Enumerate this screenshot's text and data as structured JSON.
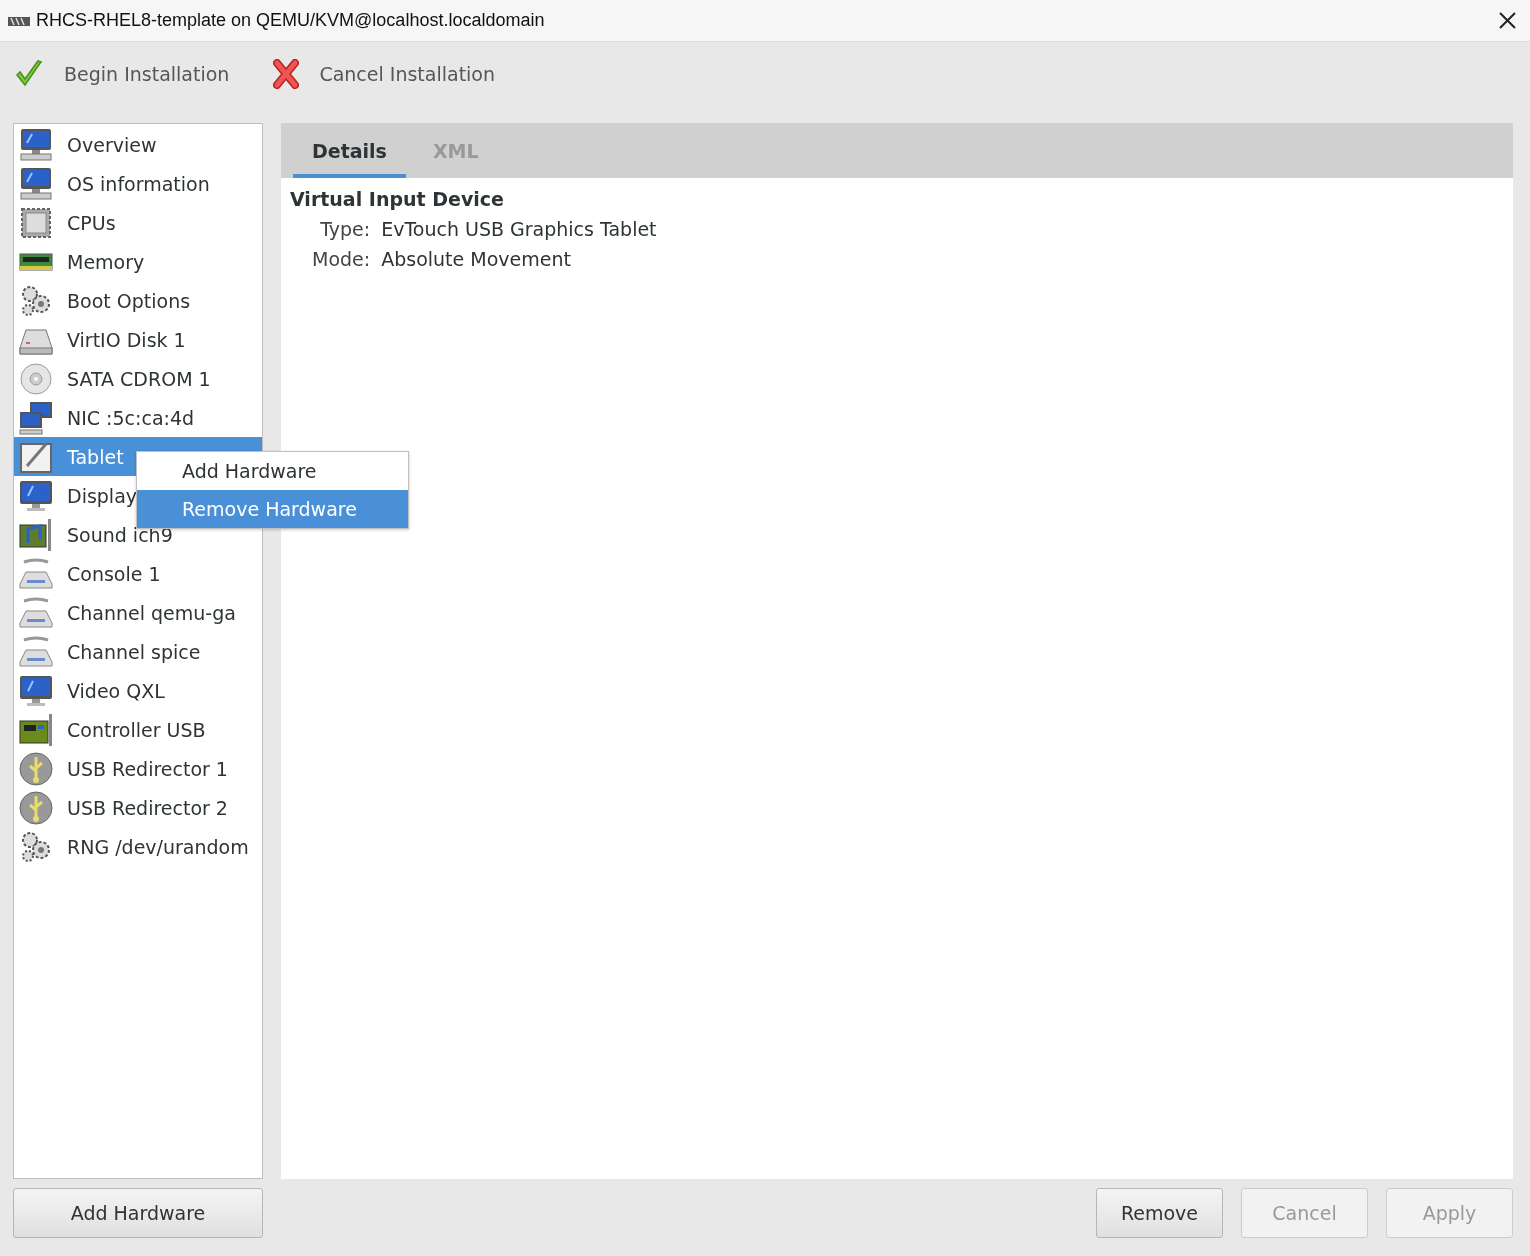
{
  "window": {
    "title": "RHCS-RHEL8-template on QEMU/KVM@localhost.localdomain"
  },
  "toolbar": [
    {
      "kind": "begin",
      "label": "Begin Installation"
    },
    {
      "kind": "cancel",
      "label": "Cancel Installation"
    }
  ],
  "sidebar": {
    "items": [
      {
        "kind": "computer",
        "label": "Overview",
        "selected": false
      },
      {
        "kind": "computer",
        "label": "OS information",
        "selected": false
      },
      {
        "kind": "chip",
        "label": "CPUs",
        "selected": false
      },
      {
        "kind": "memory",
        "label": "Memory",
        "selected": false
      },
      {
        "kind": "gears",
        "label": "Boot Options",
        "selected": false
      },
      {
        "kind": "disk",
        "label": "VirtIO Disk 1",
        "selected": false
      },
      {
        "kind": "cdrom",
        "label": "SATA CDROM 1",
        "selected": false
      },
      {
        "kind": "network",
        "label": "NIC :5c:ca:4d",
        "selected": false
      },
      {
        "kind": "tablet",
        "label": "Tablet",
        "selected": true
      },
      {
        "kind": "monitor",
        "label": "Display",
        "selected": false
      },
      {
        "kind": "sound",
        "label": "Sound ich9",
        "selected": false
      },
      {
        "kind": "serial",
        "label": "Console 1",
        "selected": false
      },
      {
        "kind": "serial",
        "label": "Channel qemu-ga",
        "selected": false
      },
      {
        "kind": "serial",
        "label": "Channel spice",
        "selected": false
      },
      {
        "kind": "monitor",
        "label": "Video QXL",
        "selected": false
      },
      {
        "kind": "card",
        "label": "Controller USB",
        "selected": false
      },
      {
        "kind": "usb",
        "label": "USB Redirector 1",
        "selected": false
      },
      {
        "kind": "usb",
        "label": "USB Redirector 2",
        "selected": false
      },
      {
        "kind": "gears",
        "label": "RNG /dev/urandom",
        "selected": false
      }
    ],
    "button": {
      "label": "Add Hardware",
      "disabled": false
    }
  },
  "tabs": [
    {
      "label": "Details",
      "selected": true
    },
    {
      "label": "XML",
      "selected": false
    }
  ],
  "details": {
    "heading": "Virtual Input Device",
    "fields": [
      {
        "label": "Type:",
        "value": "EvTouch USB Graphics Tablet"
      },
      {
        "label": "Mode:",
        "value": "Absolute Movement"
      }
    ]
  },
  "context_menu": {
    "items": [
      {
        "label": "Add Hardware",
        "selected": false
      },
      {
        "label": "Remove Hardware",
        "selected": true
      }
    ]
  },
  "buttons": [
    {
      "label": "Remove",
      "disabled": false
    },
    {
      "label": "Cancel",
      "disabled": true
    },
    {
      "label": "Apply",
      "disabled": true
    }
  ]
}
